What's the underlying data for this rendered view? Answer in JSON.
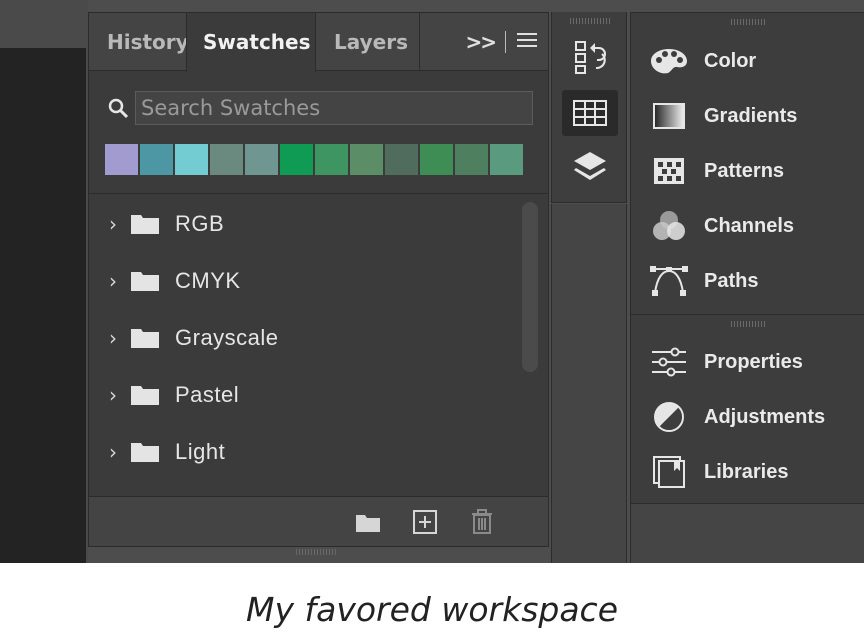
{
  "tabs": [
    {
      "label": "History"
    },
    {
      "label": "Swatches"
    },
    {
      "label": "Layers"
    }
  ],
  "tab_overflow_label": ">>",
  "search": {
    "placeholder": "Search Swatches",
    "value": ""
  },
  "swatch_colors": [
    "#a29bd0",
    "#4d96a4",
    "#73ccd2",
    "#6a8a80",
    "#6f9691",
    "#0f9b54",
    "#3f9561",
    "#5b8e66",
    "#506c5c",
    "#3e8d55",
    "#4e7f5e",
    "#5a9a7e"
  ],
  "folders": [
    {
      "label": "RGB"
    },
    {
      "label": "CMYK"
    },
    {
      "label": "Grayscale"
    },
    {
      "label": "Pastel"
    },
    {
      "label": "Light"
    }
  ],
  "right_panel_group1": [
    {
      "label": "Color",
      "icon": "color-palette-icon"
    },
    {
      "label": "Gradients",
      "icon": "gradient-icon"
    },
    {
      "label": "Patterns",
      "icon": "pattern-icon"
    },
    {
      "label": "Channels",
      "icon": "channels-icon"
    },
    {
      "label": "Paths",
      "icon": "paths-icon"
    }
  ],
  "right_panel_group2": [
    {
      "label": "Properties",
      "icon": "properties-icon"
    },
    {
      "label": "Adjustments",
      "icon": "adjustments-icon"
    },
    {
      "label": "Libraries",
      "icon": "libraries-icon"
    }
  ],
  "caption": "My favored workspace",
  "colors": {
    "panel_bg": "#3b3b3b",
    "text": "#e6e6e6",
    "active_tab_text": "#f2f2f2"
  }
}
